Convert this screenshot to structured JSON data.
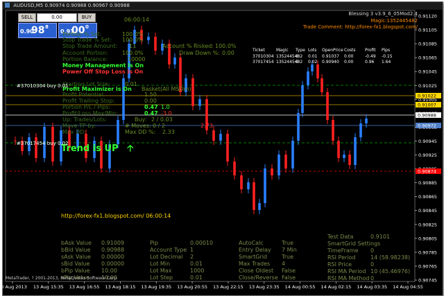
{
  "window": {
    "title": "AUDUSD,M5",
    "header_quote": "0.90974 0.90988 0.90967 0.90988"
  },
  "trade_panel": {
    "sell_label": "SELL",
    "buy_label": "BUY",
    "lot_value": "0.00",
    "sell_price_main": "0.90",
    "sell_price_big": "98",
    "sell_price_sup": "8",
    "buy_price_main": "0.91",
    "buy_price_big": "00",
    "buy_price_sup": "0"
  },
  "ea": {
    "name": "Blessing 3 v3.9_6_05Mod2.4",
    "magic": "Magic:1352445482",
    "comment": "Trade Comment: http://forex-fx1.blogspot.com/",
    "timer": "06:00:14",
    "trend": "Trend is UP",
    "website_line": "http://forex-fx1.blogspot.com/   06:00:14"
  },
  "ea_left": [
    {
      "text": "Portion % Set:",
      "color": "#3c6e1e"
    },
    {
      "text": "Stop Trade % Set:",
      "color": "#3c6e1e"
    },
    {
      "text": "Stop Trade Amount:",
      "color": "#3c6e1e"
    },
    {
      "text": "Account Portion:",
      "color": "#3c6e1e"
    },
    {
      "text": "Portion Balance:",
      "color": "#3c6e1e"
    },
    {
      "text": "Money Management is On",
      "color": "#33ff33"
    },
    {
      "text": "Power Off Stop Loss is On",
      "color": "#ff3333"
    },
    {
      "text": "Starting Lot Size:",
      "color": "#3c6e1e"
    },
    {
      "text": "Profit Maximizer is On",
      "color": "#33ff33"
    },
    {
      "text": "Profit Potential:",
      "color": "#3c6e1e"
    },
    {
      "text": "Profit Trailing Stop:",
      "color": "#3c6e1e"
    },
    {
      "text": "Portion P/L / Pips:",
      "color": "#3c6e1e"
    },
    {
      "text": "Profit/Loss Max/Min:",
      "color": "#3c6e1e"
    },
    {
      "text": "Up: Trades/Lots:",
      "color": "#3c6e1e"
    },
    {
      "text": "Move TP by:",
      "color": "#3c6e1e"
    },
    {
      "text": "Max DD:",
      "color": "#3c6e1e"
    }
  ],
  "ea_values": {
    "portion_pct": "100.0%",
    "stop_trade_pct": "100.0%",
    "stop_trade_amount": "11",
    "account_portion": "100.0%",
    "portion_balance": "10000",
    "starting_lot": "0.01",
    "profit_potential": "1.50",
    "profit_trailing": "0.00",
    "pl_pips": "0.47",
    "pl_pips2": "1.0",
    "pl_maxmin": "0.47",
    "pl_maxmin2": "-3.0",
    "basket_label": "Basket(All MSDm)",
    "buy_trades": "Buy:",
    "buy_trades_val": "2 / 0.03",
    "moves_label": "# Moves:",
    "moves_val": "0 / 2",
    "max_dd_pct_label": "Max DD %:",
    "max_dd_pct": "2.33",
    "account_risked_label": "Account % Risked:",
    "account_risked": "100.0%",
    "draw_down_label": "Draw Down %:",
    "draw_down": "0.00",
    "red_val": "2.73"
  },
  "ticket_table": {
    "headers": [
      "Ticket",
      "Magic",
      "Type",
      "Lots",
      "OpenPrice",
      "Costs",
      "Profit",
      "Pips"
    ],
    "rows": [
      [
        "37010304",
        "1352445482",
        "0",
        "0.01",
        "0.91037",
        "0.00",
        "-0.49",
        "-0.15"
      ],
      [
        "37017454",
        "1352445482",
        "0",
        "0.02",
        "0.90940",
        "0.00",
        "0.96",
        "1.64"
      ]
    ]
  },
  "order_labels": [
    {
      "text": "#37010304 buy 0.01"
    },
    {
      "text": "#37017454 buy 0.02"
    }
  ],
  "settings": {
    "col1": [
      {
        "label": "bAsk Value",
        "value": "0.91009"
      },
      {
        "label": "bBid Value",
        "value": "0.90988"
      },
      {
        "label": "sAsk Value",
        "value": "0.00000"
      },
      {
        "label": "sBid Value",
        "value": "0.00000"
      },
      {
        "label": "bPip Value",
        "value": "10.00"
      },
      {
        "label": "sPip Value",
        "value": "10.00"
      }
    ],
    "col2": [
      {
        "label": "Pip",
        "value": "0.00010"
      },
      {
        "label": "Account Type",
        "value": "1"
      },
      {
        "label": "Lot Decimal",
        "value": "2"
      },
      {
        "label": "Lot Min",
        "value": "0.01"
      },
      {
        "label": "Lot Max",
        "value": "1000"
      },
      {
        "label": "Lot Step",
        "value": "0.01"
      }
    ],
    "col3": [
      {
        "label": "AutoCalc",
        "value": "True"
      },
      {
        "label": "Entry Delay",
        "value": "7 Min"
      },
      {
        "label": "SmartGrid",
        "value": "True"
      },
      {
        "label": "Max Trades",
        "value": "4"
      },
      {
        "label": "Close Oldest",
        "value": "False"
      },
      {
        "label": "Close/Reverse",
        "value": "False"
      }
    ],
    "col4": [
      {
        "label": "Test Data",
        "value": "0.9101"
      },
      {
        "label": "SmartGrid Settings",
        "value": ""
      },
      {
        "label": "TimeFrame",
        "value": "0"
      },
      {
        "label": "RSI Period",
        "value": "14 (58.98238)"
      },
      {
        "label": "RSI Price",
        "value": "0"
      },
      {
        "label": "RSI MA Period",
        "value": "10 (45.46976)"
      },
      {
        "label": "RSI MA Method",
        "value": "0"
      }
    ]
  },
  "price_axis": {
    "ticks": [
      "0.91120",
      "0.91105",
      "0.91085",
      "0.91065",
      "0.91045",
      "0.91025",
      "0.91005",
      "0.90985",
      "0.90965",
      "0.90945",
      "0.90925",
      "0.90905",
      "0.90885",
      "0.90865",
      "0.90845",
      "0.90825",
      "0.90805",
      "0.90785",
      "0.90765",
      "0.90745"
    ],
    "markers": [
      {
        "text": "0.91022",
        "bg": "#ffd700",
        "color": "#000000"
      },
      {
        "text": "0.91007",
        "bg": "#ffd700",
        "color": "#000000"
      },
      {
        "text": "0.90988",
        "bg": "#ffffff",
        "color": "#000000"
      },
      {
        "text": "0.90972",
        "bg": "#4f7fc8",
        "color": "#ffffff"
      },
      {
        "text": "0.90874",
        "bg": "#ff0000",
        "color": "#ffffff"
      }
    ]
  },
  "time_axis": {
    "ticks": [
      "13 Aug 2013",
      "13 Aug 15:35",
      "13 Aug 16:55",
      "13 Aug 18:15",
      "13 Aug 19:35",
      "13 Aug 20:55",
      "13 Aug 22:15",
      "13 Aug 23:35",
      "14 Aug 00:55",
      "14 Aug 02:15",
      "14 Aug 03:35",
      "14 Aug 04:55"
    ]
  },
  "footer": "MetaTrader, ? 2001-2013, MetaQuotes Software Corp.",
  "colors": {
    "bull": "#2a7fff",
    "bear": "#ff2020",
    "ea_text": "#6b8e23",
    "settings_text": "#7a8a4a",
    "trend": "#33ff33"
  }
}
